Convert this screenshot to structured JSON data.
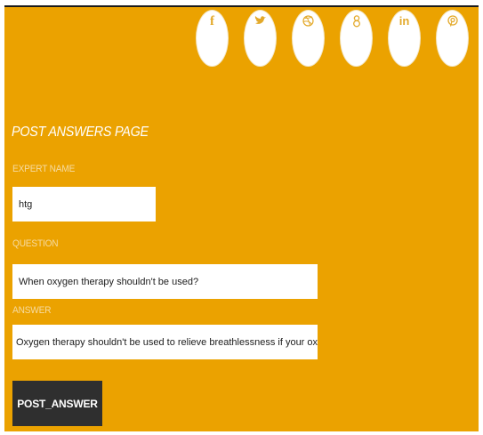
{
  "social": [
    {
      "icon": "facebook-icon",
      "glyph": "f"
    },
    {
      "icon": "twitter-icon",
      "glyph": "t"
    },
    {
      "icon": "dribbble-icon",
      "glyph": "d"
    },
    {
      "icon": "google-plus-icon",
      "glyph": "8"
    },
    {
      "icon": "linkedin-icon",
      "glyph": "in"
    },
    {
      "icon": "pinterest-icon",
      "glyph": "p"
    }
  ],
  "form": {
    "title": "POST ANSWERS PAGE",
    "expert_label": "EXPERT NAME",
    "expert_value": "htg",
    "question_label": "QUESTION",
    "question_value": "When oxygen therapy shouldn't be used?",
    "answer_label": "ANSWER",
    "answer_value": "Oxygen therapy shouldn't be used to relieve breathlessness if your oxygen levels are norm",
    "submit_label": "POST_ANSWER"
  },
  "colors": {
    "background": "#eba200",
    "button": "#2f2f2f",
    "label": "#f6dba1"
  }
}
